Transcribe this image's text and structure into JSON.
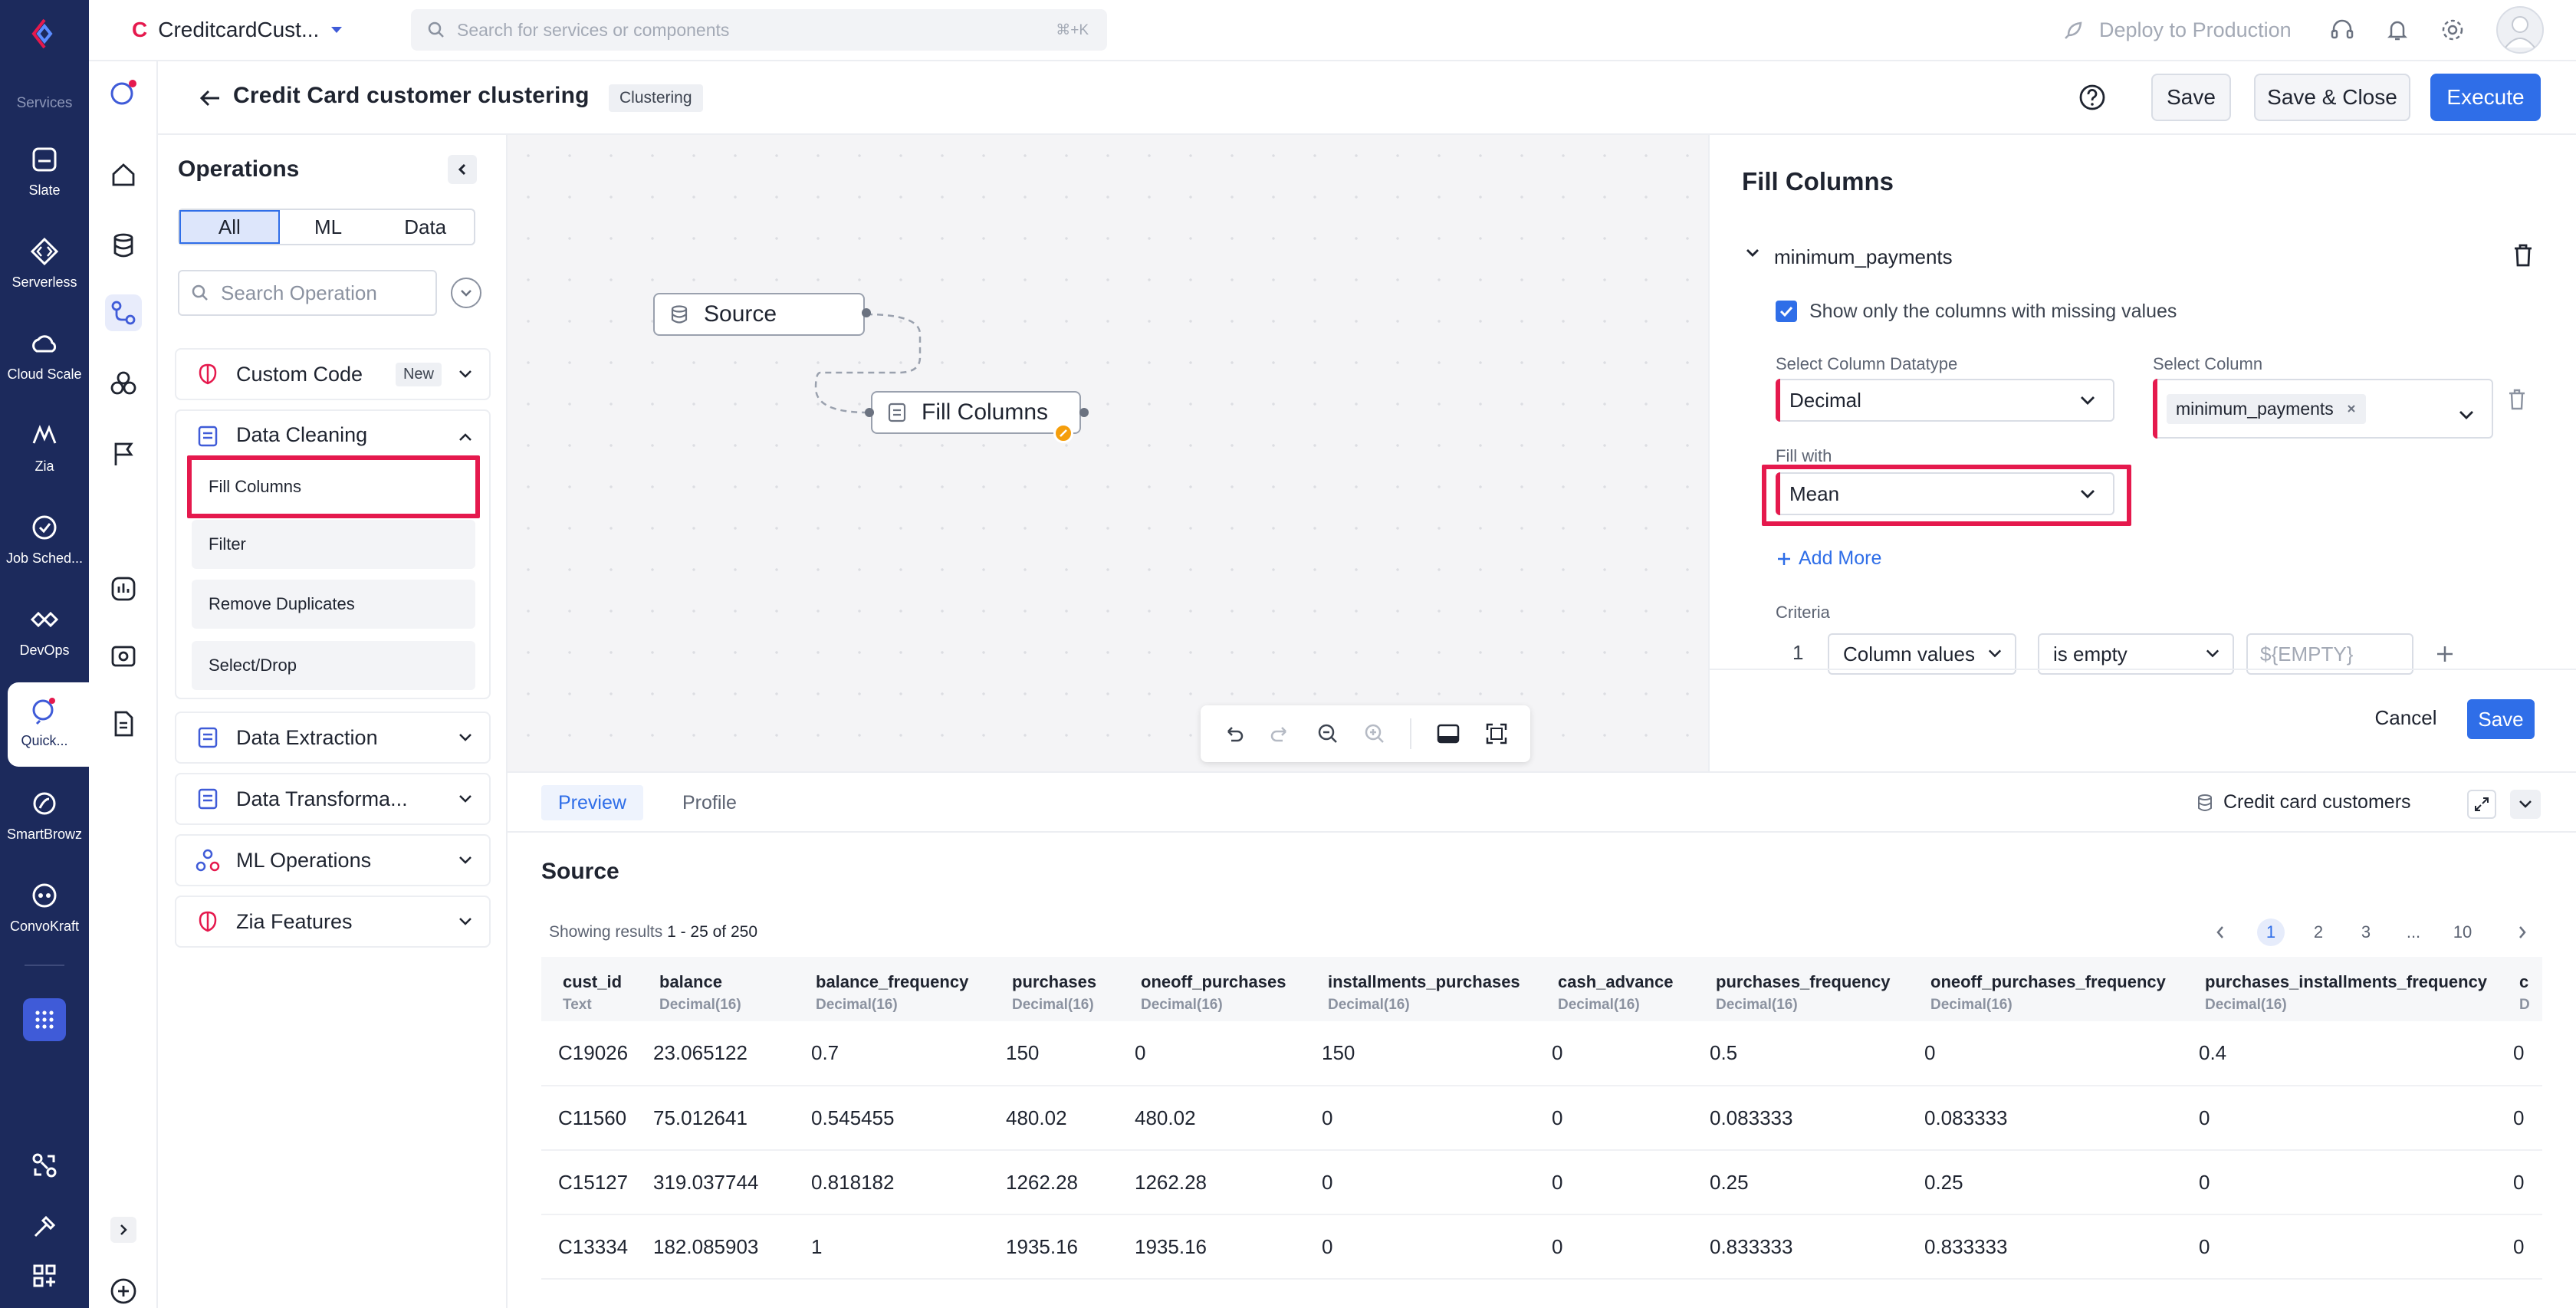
{
  "app": {
    "project_letter": "C",
    "project_name": "CreditcardCust...",
    "search_placeholder": "Search for services or components",
    "search_shortcut": "⌘+K",
    "deploy_label": "Deploy to Production"
  },
  "rail": {
    "section_label": "Services",
    "items": [
      {
        "label": "Slate",
        "icon": "slate-icon"
      },
      {
        "label": "Serverless",
        "icon": "serverless-icon"
      },
      {
        "label": "Cloud Scale",
        "icon": "cloud-icon"
      },
      {
        "label": "Zia",
        "icon": "zia-icon"
      },
      {
        "label": "Job Sched...",
        "icon": "clock-icon"
      },
      {
        "label": "DevOps",
        "icon": "devops-icon"
      },
      {
        "label": "Quick...",
        "icon": "quickml-icon"
      },
      {
        "label": "SmartBrowz",
        "icon": "smartbrowz-icon"
      },
      {
        "label": "ConvoKraft",
        "icon": "convokraft-icon"
      }
    ]
  },
  "header": {
    "title": "Credit Card customer clustering",
    "badge": "Clustering",
    "save": "Save",
    "save_close": "Save & Close",
    "execute": "Execute"
  },
  "operations": {
    "title": "Operations",
    "tabs": [
      "All",
      "ML",
      "Data"
    ],
    "search_placeholder": "Search Operation",
    "custom_code": "Custom Code",
    "new_badge": "New",
    "data_cleaning": "Data Cleaning",
    "cleaning_items": [
      "Fill Columns",
      "Filter",
      "Remove Duplicates",
      "Select/Drop"
    ],
    "data_extraction": "Data Extraction",
    "data_transformation": "Data Transforma...",
    "ml_operations": "ML Operations",
    "zia_features": "Zia Features"
  },
  "canvas": {
    "source_node": "Source",
    "fill_node": "Fill Columns"
  },
  "fill_panel": {
    "title": "Fill Columns",
    "column_name": "minimum_payments",
    "checkbox_label": "Show only the columns with missing values",
    "checkbox_checked": true,
    "datatype_label": "Select Column Datatype",
    "datatype_value": "Decimal",
    "column_label": "Select Column",
    "column_chip": "minimum_payments",
    "fill_with_label": "Fill with",
    "fill_with_value": "Mean",
    "add_more": "Add More",
    "criteria_label": "Criteria",
    "criteria_index": "1",
    "criteria_column": "Column values",
    "criteria_op": "is empty",
    "criteria_value_placeholder": "${EMPTY}",
    "cancel": "Cancel",
    "save": "Save"
  },
  "bottom": {
    "tabs": [
      "Preview",
      "Profile"
    ],
    "dataset": "Credit card customers",
    "section_title": "Source",
    "showing_prefix": "Showing results ",
    "showing_range": "1 - 25 of 250",
    "pages": [
      "1",
      "2",
      "3",
      "...",
      "10"
    ],
    "columns": [
      {
        "name": "cust_id",
        "type": "Text"
      },
      {
        "name": "balance",
        "type": "Decimal(16)"
      },
      {
        "name": "balance_frequency",
        "type": "Decimal(16)"
      },
      {
        "name": "purchases",
        "type": "Decimal(16)"
      },
      {
        "name": "oneoff_purchases",
        "type": "Decimal(16)"
      },
      {
        "name": "installments_purchases",
        "type": "Decimal(16)"
      },
      {
        "name": "cash_advance",
        "type": "Decimal(16)"
      },
      {
        "name": "purchases_frequency",
        "type": "Decimal(16)"
      },
      {
        "name": "oneoff_purchases_frequency",
        "type": "Decimal(16)"
      },
      {
        "name": "purchases_installments_frequency",
        "type": "Decimal(16)"
      },
      {
        "name": "c",
        "type": "D"
      }
    ],
    "rows": [
      [
        "C19026",
        "23.065122",
        "0.7",
        "150",
        "0",
        "150",
        "0",
        "0.5",
        "0",
        "0.4",
        "0"
      ],
      [
        "C11560",
        "75.012641",
        "0.545455",
        "480.02",
        "480.02",
        "0",
        "0",
        "0.083333",
        "0.083333",
        "0",
        "0"
      ],
      [
        "C15127",
        "319.037744",
        "0.818182",
        "1262.28",
        "1262.28",
        "0",
        "0",
        "0.25",
        "0.25",
        "0",
        "0"
      ],
      [
        "C13334",
        "182.085903",
        "1",
        "1935.16",
        "1935.16",
        "0",
        "0",
        "0.833333",
        "0.833333",
        "0",
        "0"
      ]
    ]
  }
}
